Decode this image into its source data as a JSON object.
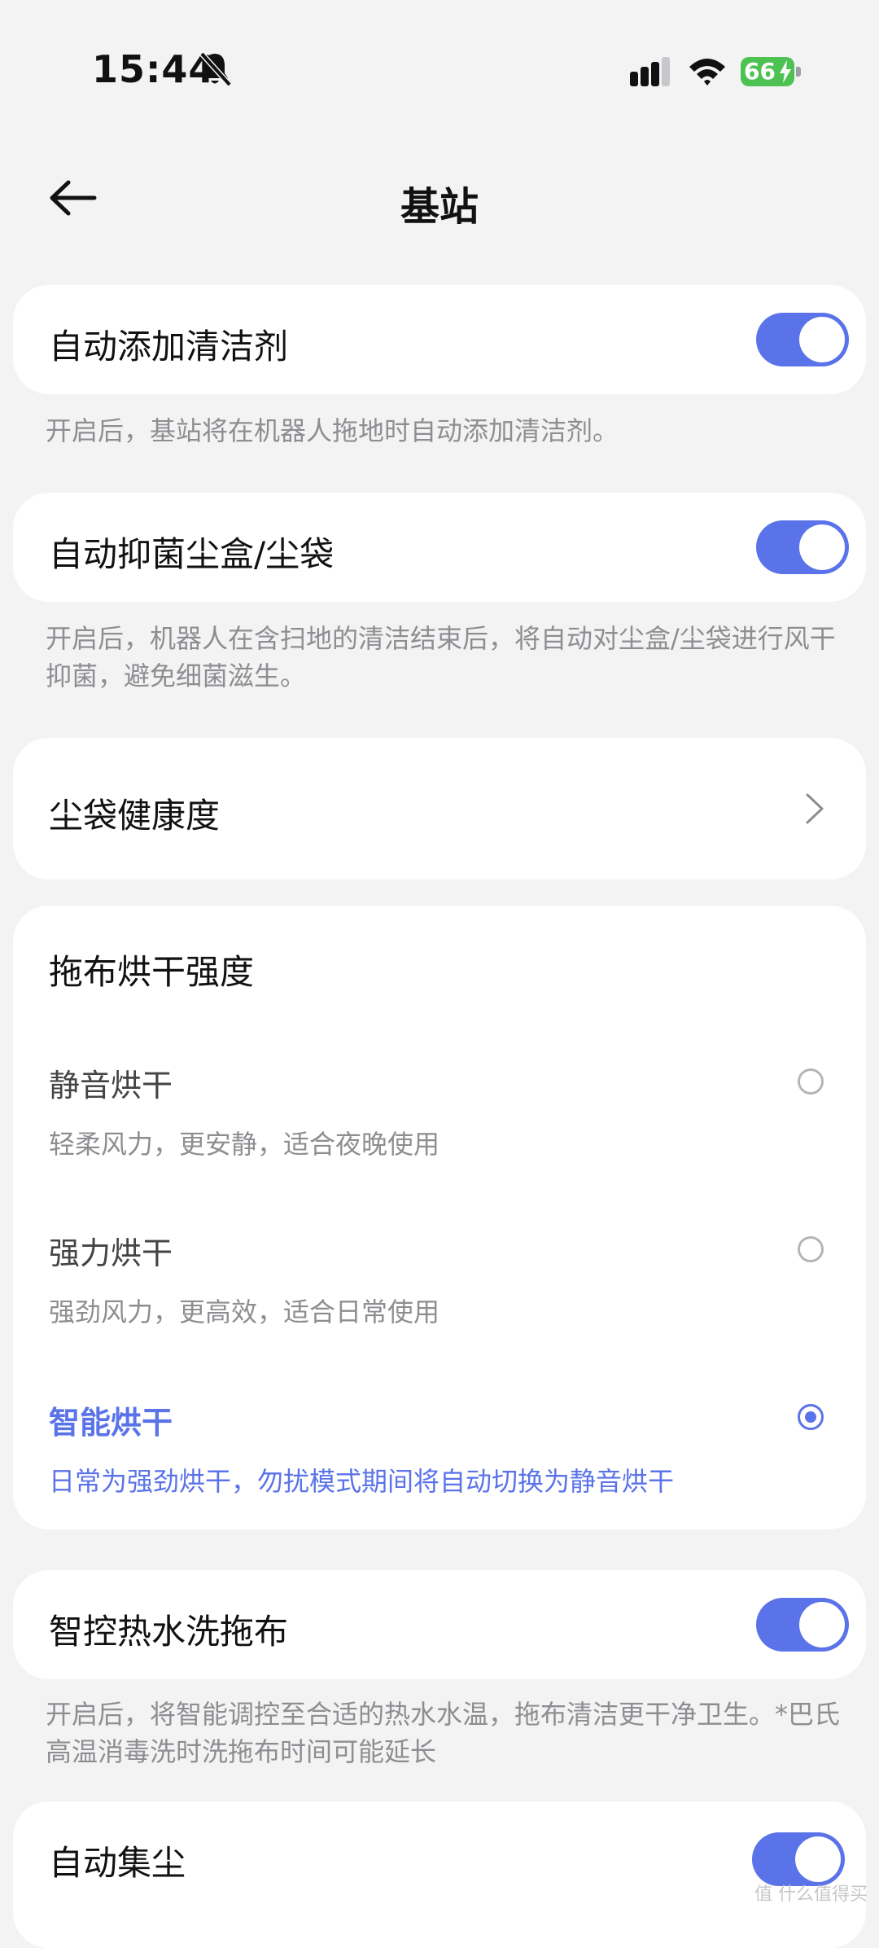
{
  "status": {
    "time": "15:44",
    "battery": "66"
  },
  "header": {
    "title": "基站"
  },
  "settings": {
    "auto_detergent": {
      "label": "自动添加清洁剂",
      "on": true,
      "desc": "开启后，基站将在机器人拖地时自动添加清洁剂。"
    },
    "antibacterial": {
      "label": "自动抑菌尘盒/尘袋",
      "on": true,
      "desc": "开启后，机器人在含扫地的清洁结束后，将自动对尘盒/尘袋进行风干抑菌，避免细菌滋生。"
    },
    "dust_bag_health": {
      "label": "尘袋健康度"
    },
    "mop_drying": {
      "label": "拖布烘干强度",
      "options": [
        {
          "title": "静音烘干",
          "desc": "轻柔风力，更安静，适合夜晚使用",
          "selected": false
        },
        {
          "title": "强力烘干",
          "desc": "强劲风力，更高效，适合日常使用",
          "selected": false
        },
        {
          "title": "智能烘干",
          "desc": "日常为强劲烘干，勿扰模式期间将自动切换为静音烘干",
          "selected": true
        }
      ]
    },
    "hot_water_wash": {
      "label": "智控热水洗拖布",
      "on": true,
      "desc": "开启后，将智能调控至合适的热水水温，拖布清洁更干净卫生。*巴氏高温消毒洗时洗拖布时间可能延长"
    },
    "auto_dust": {
      "label": "自动集尘",
      "on": true
    }
  },
  "colors": {
    "accent": "#5b73e8",
    "battery": "#4dc253",
    "background": "#f3f3f4"
  },
  "watermark": "值 什么值得买"
}
